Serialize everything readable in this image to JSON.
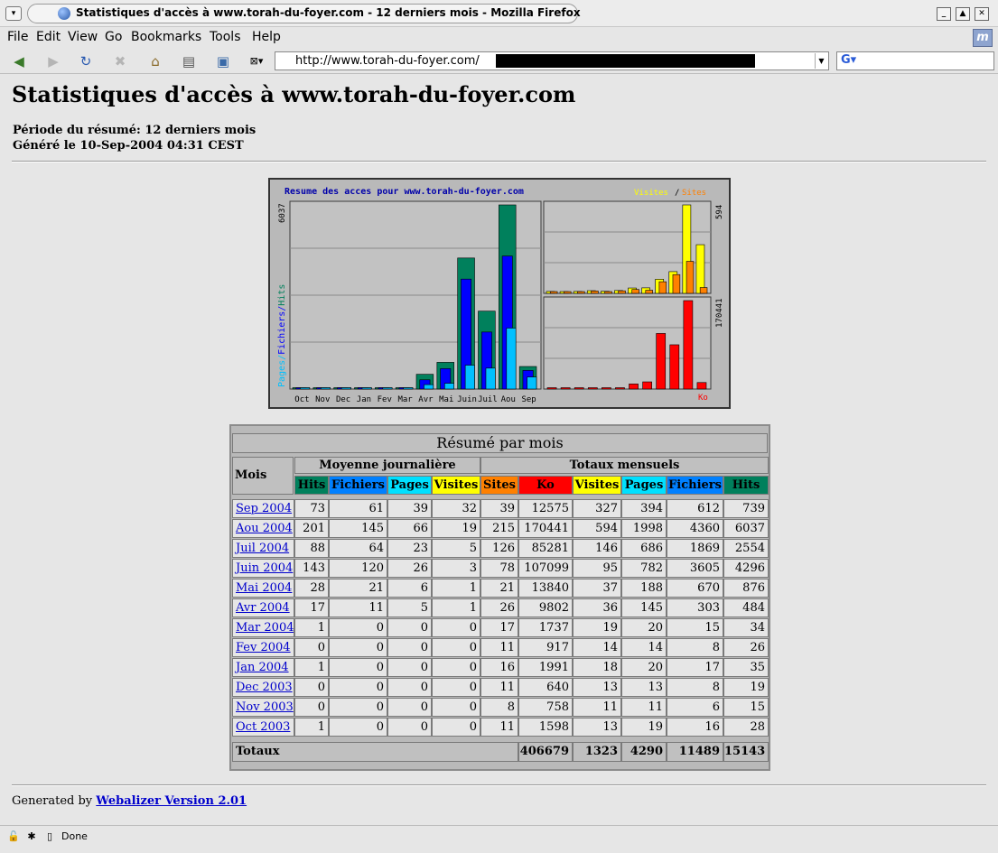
{
  "window": {
    "title": "Statistiques d'accès à www.torah-du-foyer.com - 12 derniers mois - Mozilla Firefox",
    "url": "http://www.torah-du-foyer.com/",
    "status": "Done"
  },
  "menu": {
    "file": "File",
    "edit": "Edit",
    "view": "View",
    "go": "Go",
    "bookmarks": "Bookmarks",
    "tools": "Tools",
    "help": "Help"
  },
  "icons": {
    "back": "back-arrow-icon",
    "forward": "forward-arrow-icon",
    "reload": "reload-icon",
    "stop": "stop-icon",
    "home": "home-icon",
    "print": "print-icon"
  },
  "page": {
    "title": "Statistiques d'accès à www.torah-du-foyer.com",
    "period": "Période du résumé: 12 derniers mois",
    "generated": "Généré le 10-Sep-2004 04:31 CEST",
    "footer_prefix": "Generated by",
    "footer_link": "Webalizer Version 2.01"
  },
  "chart_data": {
    "type": "bar",
    "title": "Resume des acces pour www.torah-du-foyer.com",
    "categories": [
      "Oct",
      "Nov",
      "Dec",
      "Jan",
      "Fev",
      "Mar",
      "Avr",
      "Mai",
      "Juin",
      "Juil",
      "Aou",
      "Sep"
    ],
    "left_axis_max": "6037",
    "left_axis_label": [
      "Pages",
      "Fichiers",
      "Hits"
    ],
    "top_right_max": "594",
    "top_right_legend": [
      "Visites",
      "Sites"
    ],
    "bottom_right_max": "170441",
    "bottom_right_label": "Ko",
    "series": [
      {
        "name": "Hits",
        "color": "#00805c",
        "values": [
          28,
          15,
          19,
          35,
          26,
          34,
          484,
          876,
          4296,
          2554,
          6037,
          739
        ]
      },
      {
        "name": "Fichiers",
        "color": "#0000ff",
        "values": [
          16,
          6,
          8,
          17,
          8,
          15,
          303,
          670,
          3605,
          1869,
          4360,
          612
        ]
      },
      {
        "name": "Pages",
        "color": "#00c0ff",
        "values": [
          19,
          11,
          13,
          20,
          14,
          20,
          145,
          188,
          782,
          686,
          1998,
          394
        ]
      },
      {
        "name": "Visites",
        "color": "#ffff00",
        "values": [
          13,
          11,
          13,
          18,
          14,
          19,
          36,
          37,
          95,
          146,
          594,
          327
        ]
      },
      {
        "name": "Sites",
        "color": "#ff8000",
        "values": [
          11,
          8,
          11,
          16,
          11,
          17,
          26,
          21,
          78,
          126,
          215,
          39
        ]
      },
      {
        "name": "Ko",
        "color": "#ff0000",
        "values": [
          1598,
          758,
          640,
          1991,
          917,
          1737,
          9802,
          13840,
          107099,
          85281,
          170441,
          12575
        ]
      }
    ]
  },
  "table": {
    "caption": "Résumé par mois",
    "mois_label": "Mois",
    "group_avg": "Moyenne journalière",
    "group_tot": "Totaux mensuels",
    "avg_cols": [
      {
        "label": "Hits",
        "color": "#00805c"
      },
      {
        "label": "Fichiers",
        "color": "#0080ff"
      },
      {
        "label": "Pages",
        "color": "#00e0ff"
      },
      {
        "label": "Visites",
        "color": "#ffff00"
      }
    ],
    "tot_cols": [
      {
        "label": "Sites",
        "color": "#ff8000"
      },
      {
        "label": "Ko",
        "color": "#ff0000"
      },
      {
        "label": "Visites",
        "color": "#ffff00"
      },
      {
        "label": "Pages",
        "color": "#00e0ff"
      },
      {
        "label": "Fichiers",
        "color": "#0080ff"
      },
      {
        "label": "Hits",
        "color": "#00805c"
      }
    ],
    "rows": [
      {
        "month": "Sep 2004",
        "v": [
          "73",
          "61",
          "39",
          "32",
          "39",
          "12575",
          "327",
          "394",
          "612",
          "739"
        ]
      },
      {
        "month": "Aou 2004",
        "v": [
          "201",
          "145",
          "66",
          "19",
          "215",
          "170441",
          "594",
          "1998",
          "4360",
          "6037"
        ]
      },
      {
        "month": "Juil 2004",
        "v": [
          "88",
          "64",
          "23",
          "5",
          "126",
          "85281",
          "146",
          "686",
          "1869",
          "2554"
        ]
      },
      {
        "month": "Juin 2004",
        "v": [
          "143",
          "120",
          "26",
          "3",
          "78",
          "107099",
          "95",
          "782",
          "3605",
          "4296"
        ]
      },
      {
        "month": "Mai 2004",
        "v": [
          "28",
          "21",
          "6",
          "1",
          "21",
          "13840",
          "37",
          "188",
          "670",
          "876"
        ]
      },
      {
        "month": "Avr 2004",
        "v": [
          "17",
          "11",
          "5",
          "1",
          "26",
          "9802",
          "36",
          "145",
          "303",
          "484"
        ]
      },
      {
        "month": "Mar 2004",
        "v": [
          "1",
          "0",
          "0",
          "0",
          "17",
          "1737",
          "19",
          "20",
          "15",
          "34"
        ]
      },
      {
        "month": "Fev 2004",
        "v": [
          "0",
          "0",
          "0",
          "0",
          "11",
          "917",
          "14",
          "14",
          "8",
          "26"
        ]
      },
      {
        "month": "Jan 2004",
        "v": [
          "1",
          "0",
          "0",
          "0",
          "16",
          "1991",
          "18",
          "20",
          "17",
          "35"
        ]
      },
      {
        "month": "Dec 2003",
        "v": [
          "0",
          "0",
          "0",
          "0",
          "11",
          "640",
          "13",
          "13",
          "8",
          "19"
        ]
      },
      {
        "month": "Nov 2003",
        "v": [
          "0",
          "0",
          "0",
          "0",
          "8",
          "758",
          "11",
          "11",
          "6",
          "15"
        ]
      },
      {
        "month": "Oct 2003",
        "v": [
          "1",
          "0",
          "0",
          "0",
          "11",
          "1598",
          "13",
          "19",
          "16",
          "28"
        ]
      }
    ],
    "totals_label": "Totaux",
    "totals": [
      "406679",
      "1323",
      "4290",
      "11489",
      "15143"
    ]
  }
}
